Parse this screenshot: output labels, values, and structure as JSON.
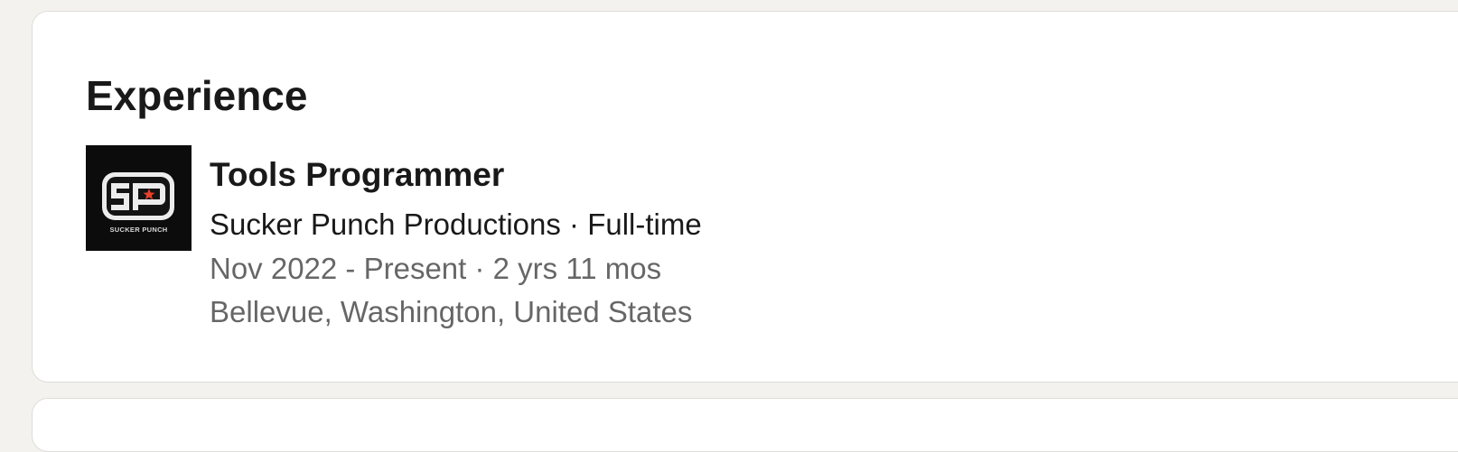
{
  "section": {
    "title": "Experience"
  },
  "experience": [
    {
      "title": "Tools Programmer",
      "company": "Sucker Punch Productions",
      "employment_type": "Full-time",
      "separator": " · ",
      "dates": "Nov 2022 - Present",
      "duration": "2 yrs 11 mos",
      "location": "Bellevue, Washington, United States",
      "logo": {
        "icon": "sucker-punch-logo",
        "letters": "SP",
        "caption": "SUCKER PUNCH"
      }
    }
  ],
  "colors": {
    "page_background": "#f3f2ef",
    "card_background": "#ffffff",
    "logo_background": "#0c0c0c",
    "logo_star": "#e8402a",
    "text_primary": "#191919",
    "text_secondary": "#666666"
  }
}
